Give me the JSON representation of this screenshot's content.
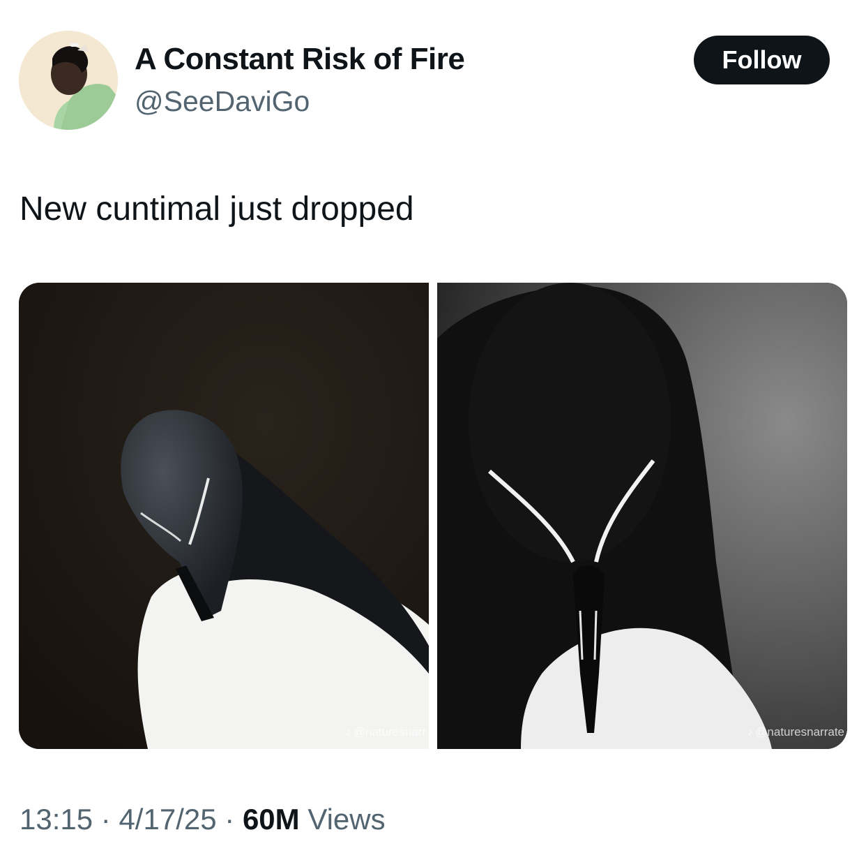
{
  "author": {
    "display_name": "A Constant Risk of Fire",
    "handle": "@SeeDaviGo"
  },
  "follow_label": "Follow",
  "tweet": {
    "text": "New cuntimal just dropped"
  },
  "media": {
    "left_watermark": "@naturesnarr",
    "right_watermark": "@naturesnarrate"
  },
  "meta": {
    "time": "13:15",
    "separator": "·",
    "date": "4/17/25",
    "views_count": "60M",
    "views_label": "Views"
  },
  "colors": {
    "text_primary": "#0f1419",
    "text_secondary": "#536471",
    "button_bg": "#0f1419"
  },
  "icons": {
    "watermark_logo": "tiktok-icon"
  }
}
